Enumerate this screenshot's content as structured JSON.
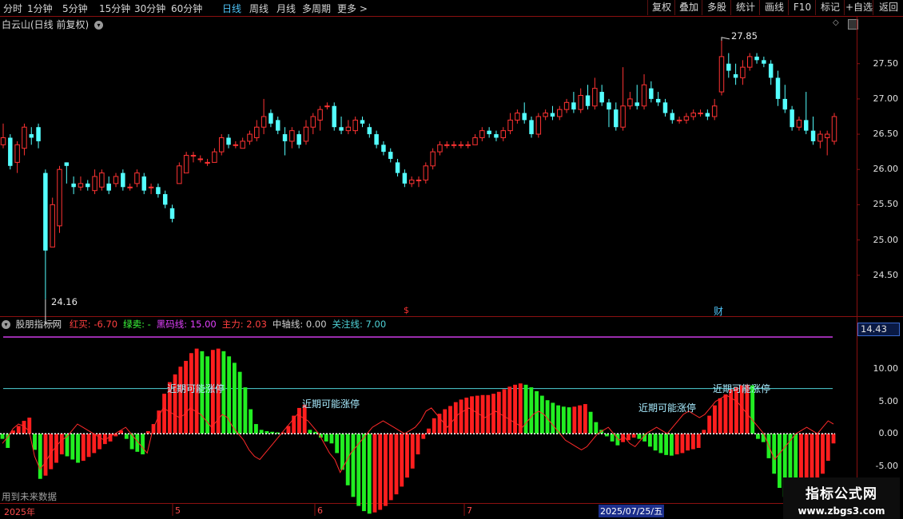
{
  "toolbar": {
    "periods": [
      "分时",
      "1分钟",
      "5分钟",
      "15分钟",
      "30分钟",
      "60分钟",
      "日线",
      "周线",
      "月线",
      "多周期",
      "更多"
    ],
    "active_period": "日线",
    "more_arrow": ">",
    "buttons": [
      "复权",
      "叠加",
      "多股",
      "统计",
      "画线",
      "F10",
      "标记",
      "+自选",
      "返回"
    ]
  },
  "stock": {
    "title": "白云山(日线 前复权)",
    "high_label": "27.85",
    "low_label": "24.16",
    "event_marks": [
      "$",
      "财"
    ]
  },
  "price_axis": [
    "27.50",
    "27.00",
    "26.50",
    "26.00",
    "25.50",
    "25.00",
    "24.50"
  ],
  "indicator": {
    "name": "股朋指标网",
    "fields": [
      {
        "label": "红买:",
        "value": "-6.70",
        "color": "#ff4040"
      },
      {
        "label": "绿卖:",
        "value": "-",
        "color": "#3cff3c"
      },
      {
        "label": "黑码线:",
        "value": "15.00",
        "color": "#e040fb"
      },
      {
        "label": "主力:",
        "value": "2.03",
        "color": "#ff4040"
      },
      {
        "label": "中轴线:",
        "value": "0.00",
        "color": "#d0d0d0"
      },
      {
        "label": "关注线:",
        "value": "7.00",
        "color": "#4fd3d8"
      }
    ],
    "axis": [
      "14.43",
      "10.00",
      "5.00",
      "0.00",
      "-5.00"
    ],
    "signal_text": "近期可能涨停",
    "footer_note": "用到未来数据"
  },
  "date_axis": {
    "labels": [
      "2025年",
      "5",
      "6",
      "7"
    ],
    "cursor_date": "2025/07/25/五"
  },
  "watermark": {
    "title": "指标公式网",
    "url": "www.zbgs3.com"
  },
  "colors": {
    "up": "#ff3333",
    "down": "#54ffff",
    "bar_red": "#ff1e1e",
    "bar_green": "#22ee22",
    "magenta": "#e040fb",
    "cyan_line": "#4fd3d8",
    "grid_red": "#8b1010"
  },
  "chart_data": {
    "type": "candlestick",
    "price_range": [
      24.1,
      27.95
    ],
    "candles": [
      [
        26.35,
        26.45,
        26.65,
        26.3
      ],
      [
        26.45,
        26.05,
        26.5,
        26.0
      ],
      [
        26.1,
        26.35,
        26.4,
        25.95
      ],
      [
        26.3,
        26.6,
        26.65,
        26.2
      ],
      [
        26.5,
        26.45,
        26.6,
        26.35
      ],
      [
        26.6,
        26.4,
        26.65,
        26.3
      ],
      [
        25.95,
        24.85,
        26.0,
        24.16
      ],
      [
        24.9,
        25.5,
        25.6,
        24.9
      ],
      [
        25.2,
        26.0,
        26.05,
        25.1
      ],
      [
        26.1,
        26.05,
        26.1,
        25.8
      ],
      [
        25.8,
        25.75,
        25.9,
        25.65
      ],
      [
        25.75,
        25.8,
        25.9,
        25.7
      ],
      [
        25.8,
        25.75,
        25.85,
        25.7
      ],
      [
        25.7,
        25.9,
        26.0,
        25.65
      ],
      [
        25.75,
        25.95,
        26.0,
        25.7
      ],
      [
        25.8,
        25.7,
        25.9,
        25.65
      ],
      [
        25.8,
        25.9,
        25.95,
        25.75
      ],
      [
        25.95,
        25.75,
        26.0,
        25.7
      ],
      [
        25.75,
        25.75,
        25.8,
        25.7
      ],
      [
        25.8,
        25.95,
        26.0,
        25.75
      ],
      [
        25.9,
        25.7,
        25.95,
        25.65
      ],
      [
        25.75,
        25.75,
        25.8,
        25.65
      ],
      [
        25.75,
        25.65,
        25.8,
        25.6
      ],
      [
        25.65,
        25.5,
        25.7,
        25.45
      ],
      [
        25.45,
        25.3,
        25.5,
        25.25
      ],
      [
        25.8,
        26.05,
        26.1,
        25.8
      ],
      [
        25.95,
        26.2,
        26.25,
        25.95
      ],
      [
        26.2,
        26.2,
        26.25,
        26.1
      ],
      [
        26.15,
        26.15,
        26.2,
        26.1
      ],
      [
        26.1,
        26.1,
        26.15,
        26.05
      ],
      [
        26.1,
        26.25,
        26.3,
        26.1
      ],
      [
        26.25,
        26.45,
        26.5,
        26.2
      ],
      [
        26.45,
        26.35,
        26.5,
        26.3
      ],
      [
        26.35,
        26.35,
        26.4,
        26.3
      ],
      [
        26.3,
        26.4,
        26.45,
        26.3
      ],
      [
        26.4,
        26.5,
        26.55,
        26.35
      ],
      [
        26.45,
        26.6,
        26.7,
        26.4
      ],
      [
        26.6,
        26.75,
        27.0,
        26.5
      ],
      [
        26.8,
        26.65,
        26.85,
        26.6
      ],
      [
        26.7,
        26.55,
        26.75,
        26.5
      ],
      [
        26.5,
        26.4,
        26.6,
        26.2
      ],
      [
        26.4,
        26.55,
        26.6,
        26.3
      ],
      [
        26.5,
        26.35,
        26.55,
        26.3
      ],
      [
        26.4,
        26.6,
        26.7,
        26.35
      ],
      [
        26.6,
        26.75,
        26.8,
        26.5
      ],
      [
        26.7,
        26.85,
        26.9,
        26.55
      ],
      [
        26.9,
        26.9,
        26.95,
        26.85
      ],
      [
        26.9,
        26.6,
        26.95,
        26.55
      ],
      [
        26.6,
        26.55,
        26.75,
        26.5
      ],
      [
        26.55,
        26.6,
        26.7,
        26.5
      ],
      [
        26.55,
        26.7,
        26.75,
        26.5
      ],
      [
        26.7,
        26.65,
        26.75,
        26.6
      ],
      [
        26.6,
        26.5,
        26.65,
        26.45
      ],
      [
        26.5,
        26.35,
        26.55,
        26.3
      ],
      [
        26.35,
        26.25,
        26.4,
        26.2
      ],
      [
        26.25,
        26.15,
        26.3,
        26.1
      ],
      [
        26.1,
        25.95,
        26.15,
        25.9
      ],
      [
        25.95,
        25.8,
        26.0,
        25.75
      ],
      [
        25.8,
        25.85,
        25.9,
        25.75
      ],
      [
        25.85,
        25.85,
        25.9,
        25.75
      ],
      [
        25.85,
        26.05,
        26.1,
        25.8
      ],
      [
        26.05,
        26.25,
        26.3,
        26.0
      ],
      [
        26.25,
        26.35,
        26.4,
        26.2
      ],
      [
        26.35,
        26.35,
        26.4,
        26.3
      ],
      [
        26.35,
        26.35,
        26.4,
        26.3
      ],
      [
        26.35,
        26.35,
        26.4,
        26.3
      ],
      [
        26.35,
        26.35,
        26.4,
        26.3
      ],
      [
        26.35,
        26.45,
        26.5,
        26.35
      ],
      [
        26.45,
        26.55,
        26.6,
        26.4
      ],
      [
        26.55,
        26.5,
        26.6,
        26.45
      ],
      [
        26.5,
        26.45,
        26.55,
        26.4
      ],
      [
        26.45,
        26.55,
        26.6,
        26.4
      ],
      [
        26.55,
        26.7,
        26.8,
        26.5
      ],
      [
        26.7,
        26.8,
        26.85,
        26.65
      ],
      [
        26.8,
        26.7,
        26.95,
        26.65
      ],
      [
        26.7,
        26.5,
        26.75,
        26.45
      ],
      [
        26.5,
        26.75,
        26.8,
        26.45
      ],
      [
        26.75,
        26.8,
        26.85,
        26.7
      ],
      [
        26.8,
        26.75,
        26.9,
        26.7
      ],
      [
        26.75,
        26.85,
        26.9,
        26.7
      ],
      [
        26.85,
        26.95,
        27.0,
        26.8
      ],
      [
        26.95,
        26.85,
        27.1,
        26.8
      ],
      [
        26.85,
        27.05,
        27.15,
        26.8
      ],
      [
        27.05,
        26.9,
        27.2,
        26.85
      ],
      [
        26.9,
        27.15,
        27.3,
        26.85
      ],
      [
        27.1,
        26.95,
        27.2,
        26.9
      ],
      [
        26.95,
        26.85,
        27.0,
        26.6
      ],
      [
        26.85,
        26.6,
        26.95,
        26.55
      ],
      [
        26.6,
        26.9,
        27.45,
        26.55
      ],
      [
        26.9,
        27.0,
        27.1,
        26.85
      ],
      [
        26.95,
        26.9,
        27.2,
        26.85
      ],
      [
        26.9,
        27.2,
        27.35,
        26.85
      ],
      [
        27.15,
        27.0,
        27.25,
        26.95
      ],
      [
        27.0,
        26.95,
        27.1,
        26.9
      ],
      [
        26.95,
        26.8,
        27.0,
        26.75
      ],
      [
        26.8,
        26.7,
        26.85,
        26.65
      ],
      [
        26.7,
        26.7,
        26.75,
        26.65
      ],
      [
        26.7,
        26.75,
        26.8,
        26.65
      ],
      [
        26.75,
        26.8,
        26.85,
        26.7
      ],
      [
        26.8,
        26.8,
        26.85,
        26.75
      ],
      [
        26.8,
        26.75,
        26.85,
        26.7
      ],
      [
        26.75,
        26.9,
        27.0,
        26.7
      ],
      [
        27.1,
        27.6,
        27.85,
        27.05
      ],
      [
        27.5,
        27.4,
        27.65,
        27.3
      ],
      [
        27.35,
        27.3,
        27.5,
        27.2
      ],
      [
        27.3,
        27.45,
        27.55,
        27.2
      ],
      [
        27.45,
        27.6,
        27.65,
        27.4
      ],
      [
        27.6,
        27.55,
        27.65,
        27.5
      ],
      [
        27.55,
        27.5,
        27.6,
        27.45
      ],
      [
        27.5,
        27.3,
        27.55,
        27.2
      ],
      [
        27.3,
        27.0,
        27.4,
        26.9
      ],
      [
        27.0,
        26.85,
        27.2,
        26.8
      ],
      [
        26.85,
        26.6,
        26.9,
        26.55
      ],
      [
        26.6,
        26.7,
        26.75,
        26.55
      ],
      [
        26.7,
        26.55,
        27.1,
        26.5
      ],
      [
        26.55,
        26.4,
        26.75,
        26.35
      ],
      [
        26.4,
        26.5,
        26.55,
        26.3
      ],
      [
        26.45,
        26.5,
        26.55,
        26.2
      ],
      [
        26.4,
        26.75,
        26.8,
        26.35
      ]
    ],
    "indicator_bars": [
      -0.8,
      -2.2,
      0.5,
      1.2,
      2.0,
      2.5,
      -2.5,
      -7.0,
      -6.5,
      -5.5,
      -4.5,
      -3.2,
      -3.5,
      -4.0,
      -4.5,
      -4.2,
      -3.6,
      -3.0,
      -2.4,
      -1.6,
      -1.2,
      -0.4,
      0.5,
      -0.8,
      -2.4,
      -2.8,
      -3.2,
      0.4,
      1.5,
      3.6,
      6.2,
      8.0,
      9.2,
      10.4,
      11.3,
      12.5,
      13.2,
      12.8,
      12.0,
      13.0,
      13.2,
      12.8,
      12.0,
      11.0,
      9.6,
      7.2,
      3.8,
      1.5,
      0.6,
      0.4,
      0.3,
      0.2,
      0.2,
      1.2,
      2.8,
      4.0,
      4.5,
      0.6,
      0.3,
      -0.6,
      -1.2,
      -1.5,
      -3.0,
      -5.6,
      -8.0,
      -9.8,
      -11.2,
      -12.0,
      -12.4,
      -12.2,
      -11.8,
      -11.2,
      -10.3,
      -9.4,
      -8.2,
      -6.8,
      -5.4,
      -3.2,
      -0.8,
      0.8,
      2.4,
      3.1,
      3.8,
      4.3,
      4.9,
      5.3,
      5.6,
      5.8,
      5.9,
      6.0,
      6.0,
      6.2,
      6.5,
      6.9,
      7.3,
      7.6,
      7.8,
      7.6,
      7.2,
      6.6,
      5.9,
      5.2,
      4.8,
      4.4,
      4.2,
      4.1,
      4.2,
      4.4,
      4.6,
      3.4,
      1.8,
      0.6,
      -0.4,
      -1.2,
      -1.8,
      -1.3,
      -1.0,
      -0.6,
      -0.8,
      -1.2,
      -2.0,
      -2.6,
      -3.0,
      -3.3,
      -3.4,
      -3.2,
      -3.0,
      -2.6,
      -2.4,
      -2.2,
      0.6,
      2.8,
      4.4,
      5.5,
      6.1,
      6.9,
      7.2,
      7.5,
      7.6,
      7.5,
      -0.8,
      -1.3,
      -3.8,
      -6.2,
      -8.4,
      -9.8,
      -10.6,
      -11.0,
      -10.5,
      -9.8,
      -9.0,
      -7.8,
      -6.2,
      -4.2,
      -1.5
    ],
    "indicator_line": [
      -1.5,
      -0.5,
      0.8,
      1.5,
      1.2,
      0.4,
      -3.5,
      -5.5,
      -4.5,
      -3.0,
      -2.0,
      -1.0,
      -0.5,
      0.5,
      1.5,
      1.0,
      0.5,
      0.0,
      -0.5,
      -1.0,
      -0.5,
      0.0,
      0.5,
      1.0,
      0.0,
      -1.0,
      -2.0,
      -3.0,
      0.5,
      2.5,
      4.0,
      3.5,
      3.0,
      2.5,
      3.0,
      4.0,
      3.5,
      3.0,
      2.0,
      1.0,
      2.0,
      3.0,
      2.5,
      1.0,
      0.0,
      -1.0,
      -2.5,
      -3.5,
      -4.0,
      -3.0,
      -2.0,
      -1.0,
      0.0,
      1.0,
      2.0,
      3.0,
      2.5,
      2.0,
      1.0,
      0.0,
      -1.5,
      -3.0,
      -4.0,
      -6.0,
      -4.5,
      -3.0,
      -2.0,
      -1.0,
      0.0,
      1.0,
      1.5,
      2.0,
      1.5,
      1.0,
      0.5,
      0.0,
      0.5,
      1.0,
      2.0,
      3.5,
      4.0,
      3.0,
      2.0,
      1.0,
      2.0,
      3.0,
      3.5,
      4.0,
      3.5,
      3.0,
      2.5,
      3.0,
      3.5,
      3.0,
      2.5,
      2.0,
      1.5,
      1.0,
      2.0,
      3.0,
      3.5,
      3.0,
      2.0,
      1.0,
      0.0,
      -1.0,
      -1.5,
      -2.0,
      -2.5,
      -2.0,
      -1.0,
      0.0,
      0.5,
      1.0,
      0.0,
      -1.0,
      -0.5,
      -1.5,
      -2.0,
      -1.0,
      0.0,
      0.5,
      1.0,
      0.5,
      0.0,
      1.0,
      2.0,
      3.0,
      3.5,
      3.0,
      2.5,
      3.0,
      4.0,
      5.0,
      5.5,
      6.0,
      5.5,
      5.0,
      4.0,
      3.0,
      2.0,
      1.0,
      0.0,
      -2.0,
      -4.0,
      -3.0,
      -2.0,
      -1.0,
      0.0,
      0.5,
      1.0,
      0.5,
      0.0,
      1.0,
      2.0,
      1.5
    ],
    "indicator_range": [
      -10.5,
      16.0
    ],
    "magenta_level": 15.0,
    "cyan_level": 7.0
  }
}
